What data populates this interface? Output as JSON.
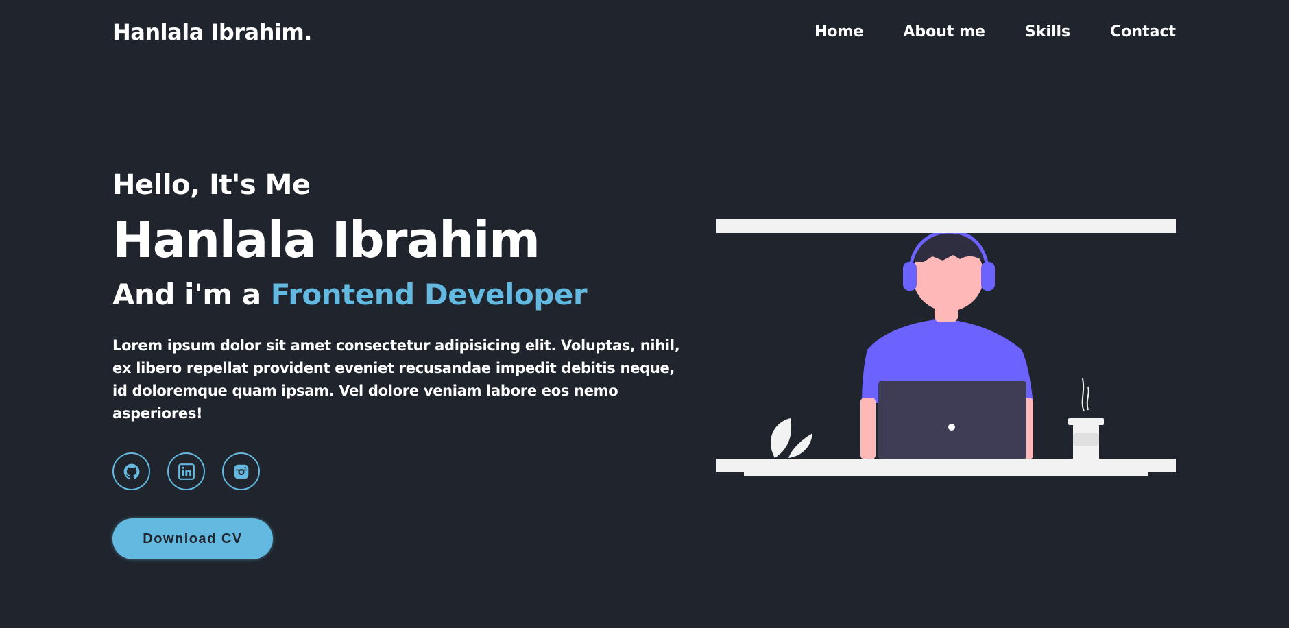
{
  "header": {
    "logo": "Hanlala Ibrahim.",
    "nav": [
      {
        "label": "Home"
      },
      {
        "label": "About me"
      },
      {
        "label": "Skills"
      },
      {
        "label": "Contact"
      }
    ]
  },
  "hero": {
    "greeting": "Hello, It's Me",
    "name": "Hanlala Ibrahim",
    "role_prefix": "And i'm a ",
    "role_highlight": "Frontend Developer",
    "description": "Lorem ipsum dolor sit amet consectetur adipisicing elit. Voluptas, nihil, ex libero repellat provident eveniet recusandae impedit debitis neque, id doloremque quam ipsam. Vel dolore veniam labore eos nemo asperiores!",
    "socials": [
      {
        "icon": "github-icon"
      },
      {
        "icon": "linkedin-icon"
      },
      {
        "icon": "instagram-icon"
      }
    ],
    "cta_label": "Download CV"
  },
  "colors": {
    "background": "#1f242d",
    "accent": "#64b9e0",
    "text": "#ffffff",
    "illustration_purple": "#6c63ff",
    "illustration_skin": "#ffb8b8",
    "laptop": "#3f3d56",
    "desk": "#f2f2f2"
  }
}
